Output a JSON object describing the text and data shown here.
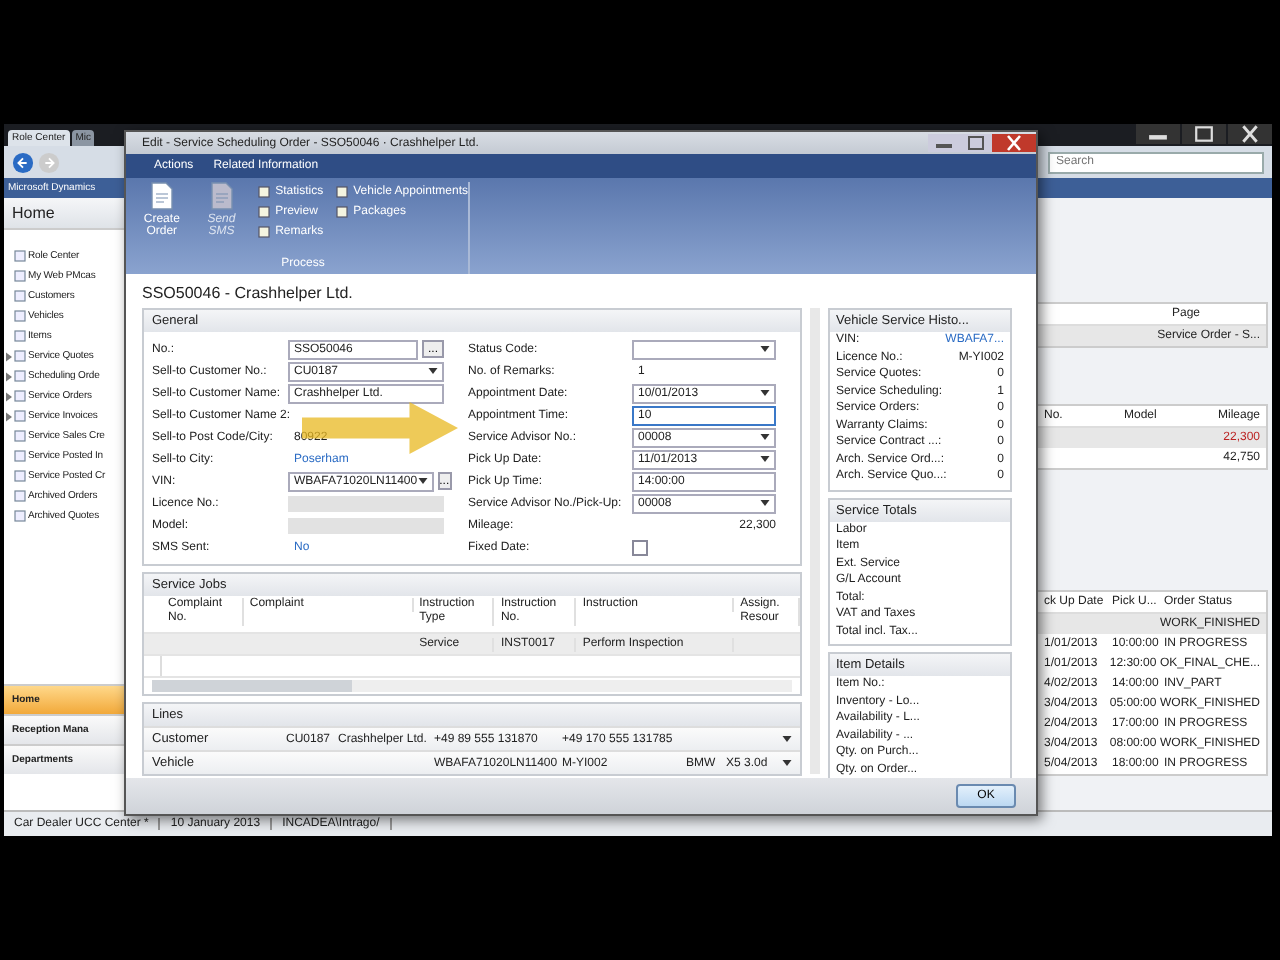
{
  "background_window": {
    "title": "Role Center",
    "tab": "Mic",
    "search": {
      "placeholder": "Search"
    },
    "address": "Microsoft Dynamics",
    "page_title": "Home",
    "nav_items": [
      {
        "label": "Role Center",
        "expandable": false
      },
      {
        "label": "My Web PMcas",
        "expandable": false
      },
      {
        "label": "Customers",
        "expandable": false
      },
      {
        "label": "Vehicles",
        "expandable": false
      },
      {
        "label": "Items",
        "expandable": false
      },
      {
        "label": "Service Quotes",
        "expandable": true
      },
      {
        "label": "Scheduling Orde",
        "expandable": true
      },
      {
        "label": "Service Orders",
        "expandable": true
      },
      {
        "label": "Service Invoices",
        "expandable": true
      },
      {
        "label": "Service Sales Cre",
        "expandable": false
      },
      {
        "label": "Service Posted In",
        "expandable": false
      },
      {
        "label": "Service Posted Cr",
        "expandable": false
      },
      {
        "label": "Archived Orders",
        "expandable": false
      },
      {
        "label": "Archived Quotes",
        "expandable": false
      }
    ],
    "nav_buttons": [
      {
        "label": "Home",
        "selected": true
      },
      {
        "label": "Reception Mana",
        "selected": false
      },
      {
        "label": "Departments",
        "selected": false
      }
    ],
    "page_panel": {
      "column": "Page",
      "row": "Service Order - S..."
    },
    "vehicles": {
      "columns": [
        "No.",
        "Model",
        "Mileage"
      ],
      "rows": [
        {
          "mileage": "22,300",
          "selected": true
        },
        {
          "mileage": "42,750",
          "selected": false
        }
      ]
    },
    "orders": {
      "columns": [
        "ck Up Date",
        "Pick U...",
        "Order Status"
      ],
      "rows": [
        {
          "date": "",
          "time": "",
          "status": "WORK_FINISHED",
          "selected": true
        },
        {
          "date": "1/01/2013",
          "time": "10:00:00",
          "status": "IN PROGRESS",
          "selected": false
        },
        {
          "date": "1/01/2013",
          "time": "12:30:00",
          "status": "OK_FINAL_CHE...",
          "selected": false
        },
        {
          "date": "4/02/2013",
          "time": "14:00:00",
          "status": "INV_PART",
          "selected": false
        },
        {
          "date": "3/04/2013",
          "time": "05:00:00",
          "status": "WORK_FINISHED",
          "selected": false
        },
        {
          "date": "2/04/2013",
          "time": "17:00:00",
          "status": "IN PROGRESS",
          "selected": false
        },
        {
          "date": "3/04/2013",
          "time": "08:00:00",
          "status": "WORK_FINISHED",
          "selected": false
        },
        {
          "date": "5/04/2013",
          "time": "18:00:00",
          "status": "IN PROGRESS",
          "selected": false
        }
      ]
    },
    "status_bar": [
      "Car Dealer UCC Center *",
      "10 January 2013",
      "INCADEA\\Intrago/"
    ]
  },
  "dialog": {
    "title": "Edit - Service Scheduling Order - SSO50046 · Crashhelper Ltd.",
    "menus": [
      "Actions",
      "Related Information"
    ],
    "ribbon": [
      {
        "label": "Create Order",
        "kind": "large",
        "disabled": false
      },
      {
        "label": "Send SMS",
        "kind": "large",
        "disabled": true
      },
      {
        "label": "Statistics",
        "kind": "small",
        "disabled": false
      },
      {
        "label": "Preview",
        "kind": "small",
        "disabled": false
      },
      {
        "label": "Remarks",
        "kind": "small",
        "disabled": false
      },
      {
        "label": "Vehicle Appointments",
        "kind": "small",
        "disabled": false
      },
      {
        "label": "Packages",
        "kind": "small",
        "disabled": false
      }
    ],
    "group_label": "Process",
    "record_title": "SSO50046 - Crashhelper Ltd.",
    "general": {
      "title": "General",
      "left_fields": [
        {
          "label": "No.:",
          "kind": "text",
          "value": "SSO50046",
          "assist": "..."
        },
        {
          "label": "Sell-to Customer No.:",
          "kind": "dropdown",
          "value": "CU0187"
        },
        {
          "label": "Sell-to Customer Name:",
          "kind": "text",
          "value": "Crashhelper Ltd."
        },
        {
          "label": "Sell-to Customer Name 2:",
          "kind": "empty"
        },
        {
          "label": "Sell-to Post Code/City:",
          "kind": "plain",
          "value": "80922"
        },
        {
          "label": "Sell-to City:",
          "kind": "link",
          "value": "Poserham"
        },
        {
          "label": "VIN:",
          "kind": "dropdown",
          "value": "WBAFA71020LN11400",
          "assist": "..."
        },
        {
          "label": "Licence No.:",
          "kind": "readonly"
        },
        {
          "label": "Model:",
          "kind": "readonly"
        },
        {
          "label": "SMS Sent:",
          "kind": "link",
          "value": "No"
        }
      ],
      "right_fields": [
        {
          "label": "Status Code:",
          "kind": "dropdown"
        },
        {
          "label": "No. of Remarks:",
          "kind": "plain",
          "value": "1"
        },
        {
          "label": "Appointment Date:",
          "kind": "dropdown",
          "value": "10/01/2013"
        },
        {
          "label": "Appointment Time:",
          "kind": "editing",
          "value": "10"
        },
        {
          "label": "Service Advisor No.:",
          "kind": "dropdown",
          "value": "00008"
        },
        {
          "label": "Pick Up Date:",
          "kind": "dropdown",
          "value": "11/01/2013"
        },
        {
          "label": "Pick Up Time:",
          "kind": "text",
          "value": "14:00:00"
        },
        {
          "label": "Service Advisor No./Pick-Up:",
          "kind": "dropdown",
          "value": "00008"
        },
        {
          "label": "Mileage:",
          "kind": "number",
          "value": "22,300"
        },
        {
          "label": "Fixed Date:",
          "kind": "checkbox",
          "checked": false
        }
      ]
    },
    "service_jobs": {
      "title": "Service Jobs",
      "columns": [
        "Complaint No.",
        "Complaint",
        "Instruction Type",
        "Instruction No.",
        "Instruction",
        "Assign. Resour"
      ],
      "rows": [
        {
          "instruction_type": "Service",
          "instruction_no": "INST0017",
          "instruction": "Perform Inspection"
        }
      ]
    },
    "lines": {
      "title": "Lines",
      "rows": [
        {
          "label": "Customer",
          "cells": [
            "CU0187",
            "Crashhelper Ltd.",
            "+49 89 555 131870",
            "+49 170 555 131785",
            "",
            ""
          ]
        },
        {
          "label": "Vehicle",
          "cells": [
            "",
            "",
            "WBAFA71020LN11400",
            "M-YI002",
            "BMW",
            "X5 3.0d"
          ]
        }
      ]
    },
    "factboxes": [
      {
        "title": "Vehicle Service Histo...",
        "rows": [
          {
            "label": "VIN:",
            "value": "WBAFA7...",
            "link": true
          },
          {
            "label": "Licence No.:",
            "value": "M-YI002",
            "link": false
          },
          {
            "label": "Service Quotes:",
            "value": "0",
            "link": false
          },
          {
            "label": "Service Scheduling:",
            "value": "1",
            "link": false
          },
          {
            "label": "Service Orders:",
            "value": "0",
            "link": false
          },
          {
            "label": "Warranty Claims:",
            "value": "0",
            "link": false
          },
          {
            "label": "Service Contract ...:",
            "value": "0",
            "link": false
          },
          {
            "label": "Arch. Service Ord...:",
            "value": "0",
            "link": false
          },
          {
            "label": "Arch. Service Quo...:",
            "value": "0",
            "link": false
          }
        ]
      },
      {
        "title": "Service Totals",
        "rows": [
          {
            "label": "Labor"
          },
          {
            "label": "Item"
          },
          {
            "label": "Ext. Service"
          },
          {
            "label": "G/L Account"
          },
          {
            "label": "Total:"
          },
          {
            "label": "VAT and Taxes"
          },
          {
            "label": "Total incl. Tax..."
          }
        ]
      },
      {
        "title": "Item Details",
        "rows": [
          {
            "label": "Item No.:"
          },
          {
            "label": "Inventory - Lo..."
          },
          {
            "label": "Availability - L..."
          },
          {
            "label": "Availability - ..."
          },
          {
            "label": "Qty. on Purch..."
          },
          {
            "label": "Qty. on Order..."
          }
        ]
      }
    ],
    "ok_button": "OK"
  }
}
